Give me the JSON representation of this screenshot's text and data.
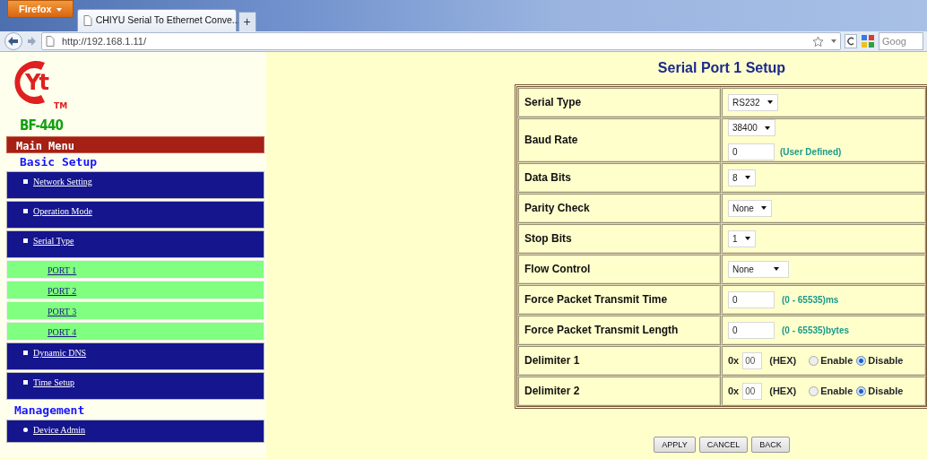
{
  "browser": {
    "menu_button": "Firefox",
    "tabs": [
      {
        "title": "CHIYU Serial To Ethernet Conve...",
        "selected": true
      }
    ],
    "new_tab": "+",
    "address": "http://192.168.1.11/",
    "search_placeholder": "Goog"
  },
  "sidebar": {
    "logo_text": "Yt",
    "logo_mark": "TM",
    "model": "BF-440",
    "main_menu": "Main Menu",
    "sections": [
      {
        "title": "Basic Setup",
        "items": [
          {
            "label": "Network Setting"
          },
          {
            "label": "Operation Mode"
          },
          {
            "label": "Serial Type",
            "children": [
              {
                "label": "PORT 1"
              },
              {
                "label": "PORT 2"
              },
              {
                "label": "PORT 3"
              },
              {
                "label": "PORT 4"
              }
            ]
          },
          {
            "label": "Dynamic DNS"
          },
          {
            "label": "Time Setup"
          }
        ]
      },
      {
        "title": "Management",
        "items": [
          {
            "label": "Device Admin"
          }
        ]
      }
    ]
  },
  "page_title": "Serial Port 1 Setup",
  "form_rows": [
    {
      "label": "Serial Type",
      "kind": "select",
      "value": "RS232"
    },
    {
      "label": "Baud Rate",
      "kind": "select_input",
      "value": "38400",
      "input": "0",
      "hint": "(User Defined)"
    },
    {
      "label": "Data Bits",
      "kind": "select",
      "value": "8"
    },
    {
      "label": "Parity Check",
      "kind": "select",
      "value": "None"
    },
    {
      "label": "Stop Bits",
      "kind": "select",
      "value": "1"
    },
    {
      "label": "Flow Control",
      "kind": "select",
      "value": "None"
    },
    {
      "label": "Force Packet Transmit Time",
      "kind": "input",
      "input": "0",
      "hint": "(0 - 65535)ms"
    },
    {
      "label": "Force Packet Transmit Length",
      "kind": "input",
      "input": "0",
      "hint": "(0 - 65535)bytes"
    },
    {
      "label": "Delimiter 1",
      "kind": "delimiter",
      "prefix": "0x",
      "input": "00",
      "unit": "(HEX)",
      "options": [
        {
          "label": "Enable",
          "selected": false
        },
        {
          "label": "Disable",
          "selected": true
        }
      ]
    },
    {
      "label": "Delimiter 2",
      "kind": "delimiter",
      "prefix": "0x",
      "input": "00",
      "unit": "(HEX)",
      "options": [
        {
          "label": "Enable",
          "selected": false
        },
        {
          "label": "Disable",
          "selected": true
        }
      ]
    }
  ],
  "buttons": [
    "APPLY",
    "CANCEL",
    "BACK"
  ]
}
